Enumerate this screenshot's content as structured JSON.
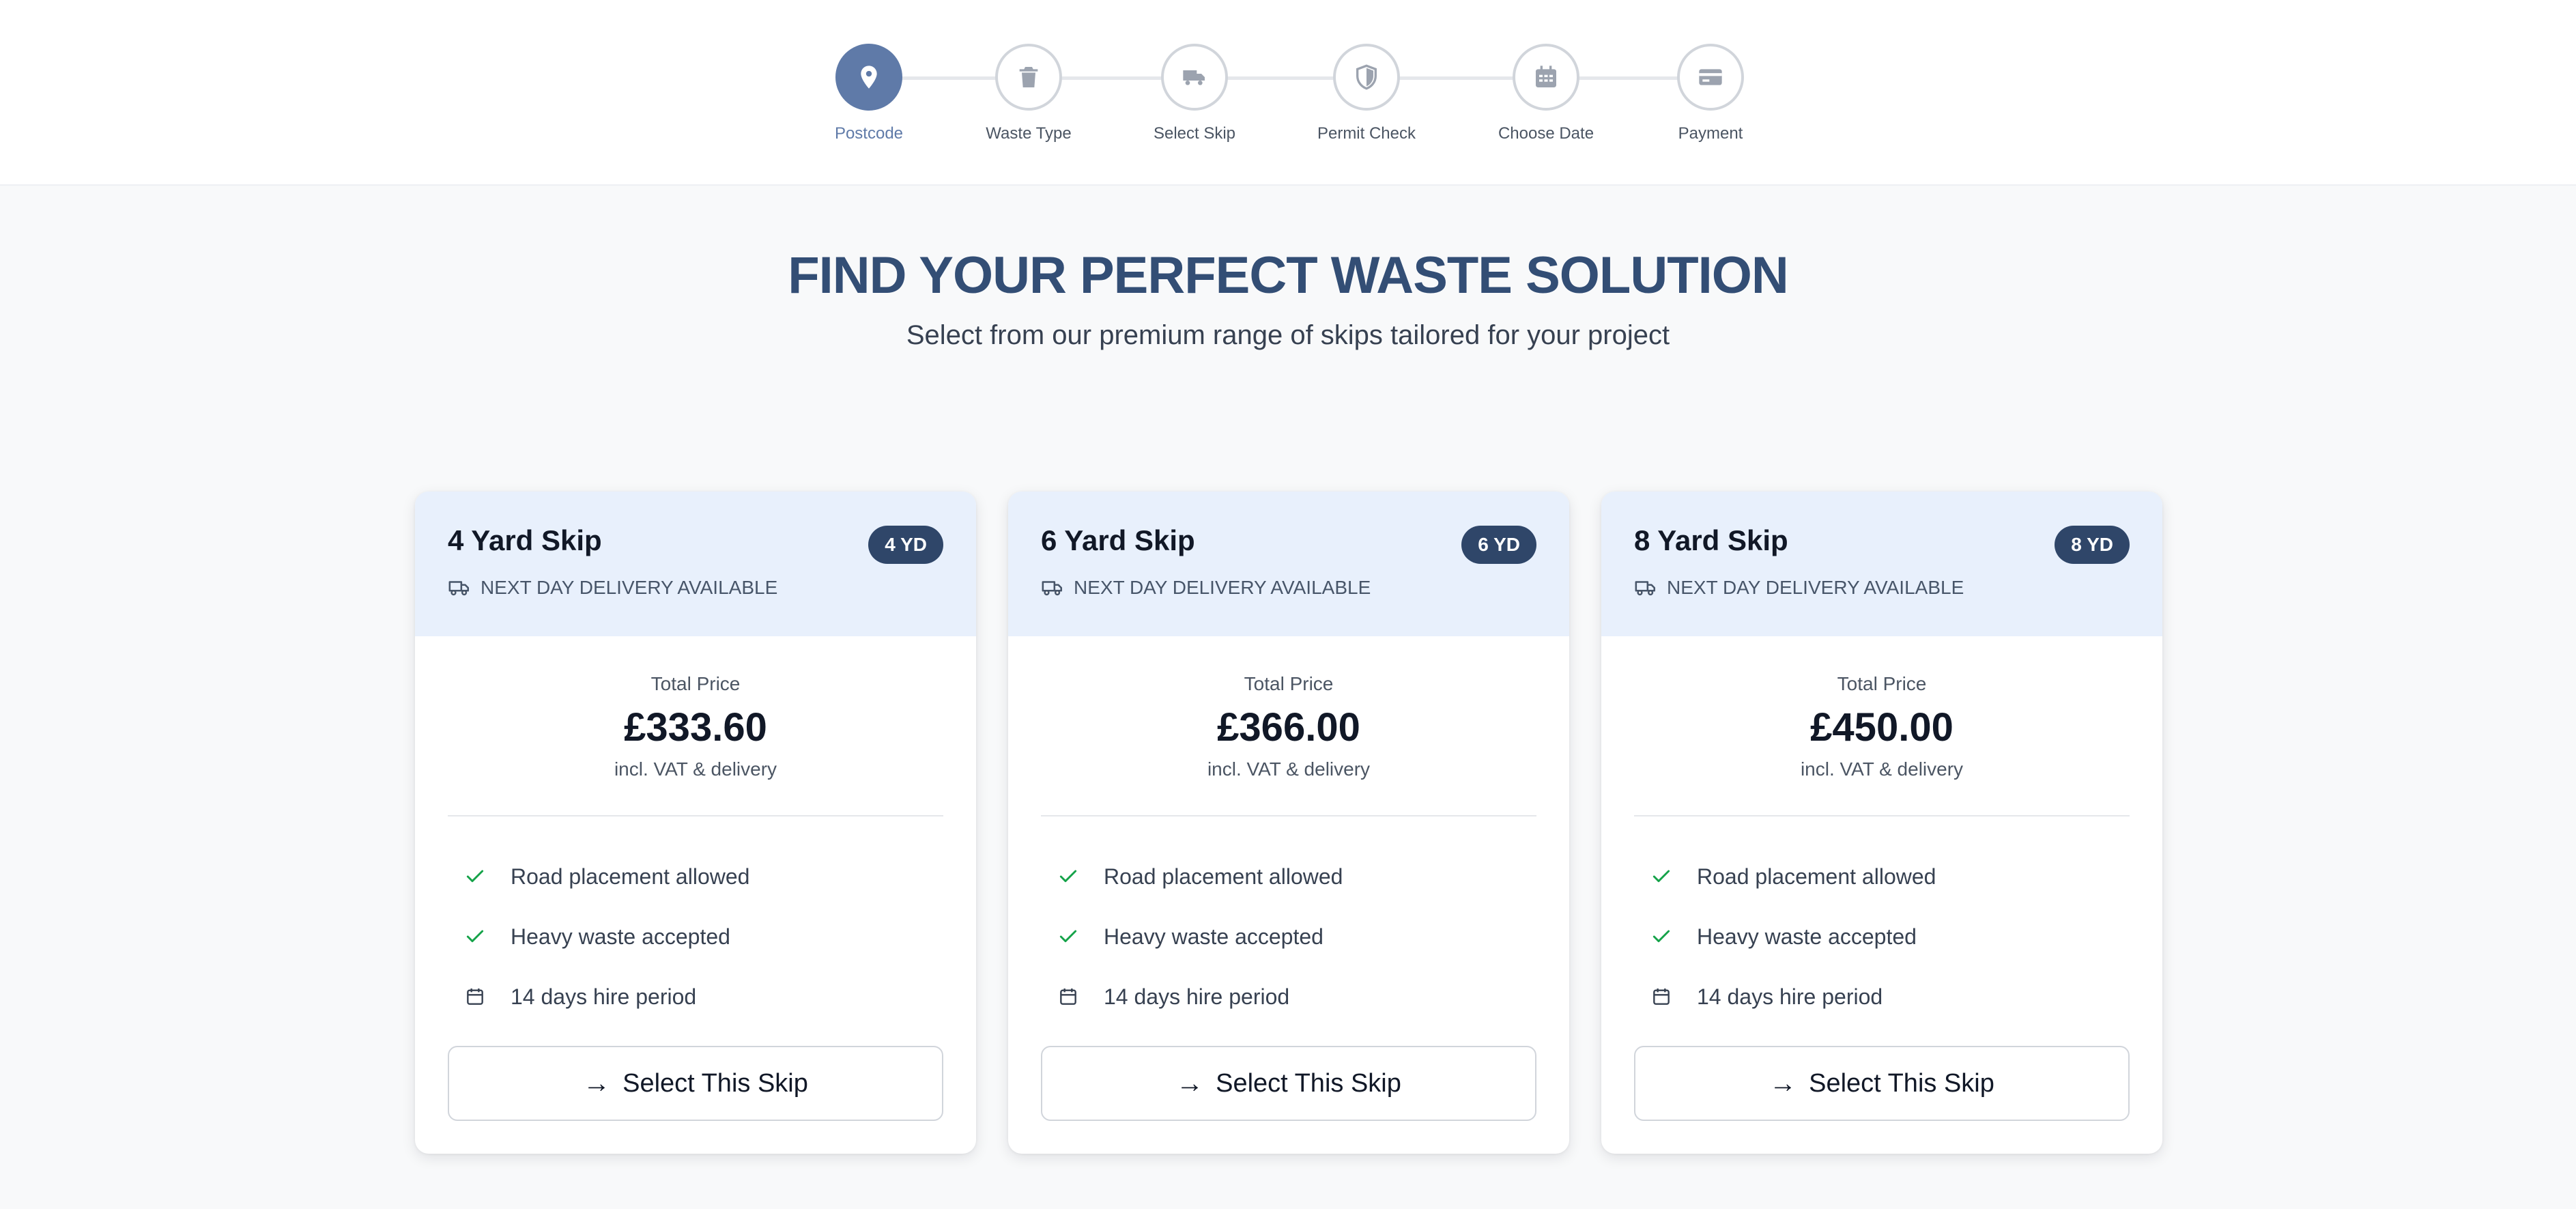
{
  "stepper": {
    "steps": [
      {
        "label": "Postcode",
        "icon": "map-pin-icon",
        "active": true
      },
      {
        "label": "Waste Type",
        "icon": "trash-icon",
        "active": false
      },
      {
        "label": "Select Skip",
        "icon": "truck-icon",
        "active": false
      },
      {
        "label": "Permit Check",
        "icon": "shield-icon",
        "active": false
      },
      {
        "label": "Choose Date",
        "icon": "calendar-icon",
        "active": false
      },
      {
        "label": "Payment",
        "icon": "credit-card-icon",
        "active": false
      }
    ]
  },
  "hero": {
    "title": "FIND YOUR PERFECT WASTE SOLUTION",
    "subtitle": "Select from our premium range of skips tailored for your project"
  },
  "cards": [
    {
      "title": "4 Yard Skip",
      "badge": "4 YD",
      "delivery": "NEXT DAY DELIVERY AVAILABLE",
      "price_label": "Total Price",
      "price": "£333.60",
      "price_note": "incl. VAT & delivery",
      "features": [
        "Road placement allowed",
        "Heavy waste accepted",
        "14 days hire period"
      ],
      "button_arrow": "→",
      "button_label": "Select This Skip"
    },
    {
      "title": "6 Yard Skip",
      "badge": "6 YD",
      "delivery": "NEXT DAY DELIVERY AVAILABLE",
      "price_label": "Total Price",
      "price": "£366.00",
      "price_note": "incl. VAT & delivery",
      "features": [
        "Road placement allowed",
        "Heavy waste accepted",
        "14 days hire period"
      ],
      "button_arrow": "→",
      "button_label": "Select This Skip"
    },
    {
      "title": "8 Yard Skip",
      "badge": "8 YD",
      "delivery": "NEXT DAY DELIVERY AVAILABLE",
      "price_label": "Total Price",
      "price": "£450.00",
      "price_note": "incl. VAT & delivery",
      "features": [
        "Road placement allowed",
        "Heavy waste accepted",
        "14 days hire period"
      ],
      "button_arrow": "→",
      "button_label": "Select This Skip"
    }
  ],
  "colors": {
    "accent": "#5f7aa8",
    "title": "#334e75",
    "badge": "#2f4669",
    "card_head": "#e8f0fc",
    "check": "#16a34a"
  }
}
